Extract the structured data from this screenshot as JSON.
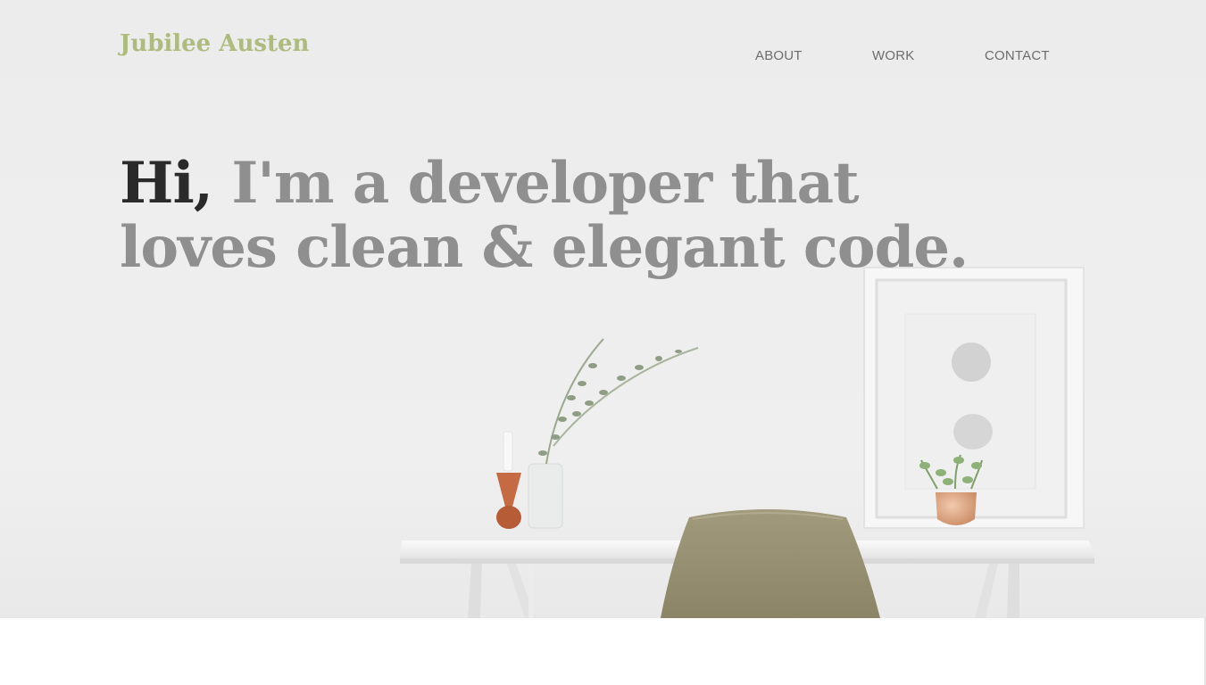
{
  "header": {
    "brand": "Jubilee Austen",
    "nav": [
      {
        "label": "ABOUT"
      },
      {
        "label": "WORK"
      },
      {
        "label": "CONTACT"
      }
    ]
  },
  "hero": {
    "greeting": "Hi,",
    "headline_rest": "I'm a developer that loves clean & elegant code."
  },
  "colors": {
    "brand": "#adbb7e",
    "headline": "#8f8f8f",
    "greeting": "#2a2a2a",
    "nav": "#6c6c6c"
  }
}
